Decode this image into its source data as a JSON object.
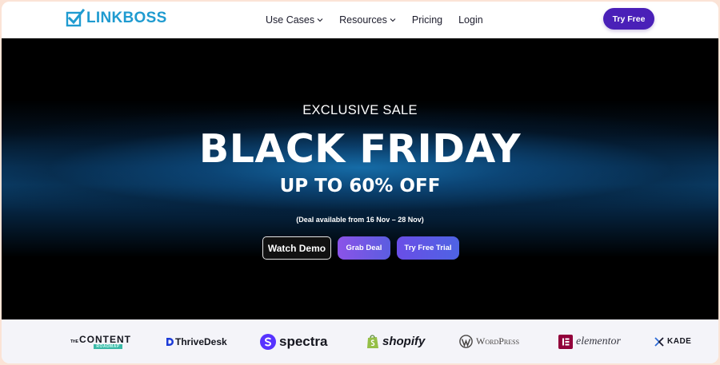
{
  "header": {
    "logo_text": "LINKBOSS",
    "nav": [
      {
        "label": "Use Cases",
        "has_dropdown": true
      },
      {
        "label": "Resources",
        "has_dropdown": true
      },
      {
        "label": "Pricing",
        "has_dropdown": false
      },
      {
        "label": "Login",
        "has_dropdown": false
      }
    ],
    "cta_label": "Try Free"
  },
  "hero": {
    "eyebrow": "EXCLUSIVE SALE",
    "headline": "BLACK FRIDAY",
    "subhead": "UP TO 60% OFF",
    "deal_note": "(Deal available from 16 Nov – 28 Nov)",
    "buttons": {
      "watch_demo": "Watch Demo",
      "grab_deal": "Grab Deal",
      "try_free_trial": "Try Free Trial"
    }
  },
  "brands": {
    "content": {
      "top": "THE",
      "main": "CONTENT",
      "sub": "ROADMAP"
    },
    "thrivedesk": "ThriveDesk",
    "spectra": "spectra",
    "shopify": "shopify",
    "wordpress": "WordPress",
    "elementor": "elementor",
    "kadence": "KADE"
  },
  "colors": {
    "brand_blue": "#1f9bd0",
    "cta_purple": "#4a20b8",
    "hero_glow": "#0b416d",
    "button_gradient_start": "#8b53e8",
    "button_gradient_end": "#5b5de0"
  }
}
